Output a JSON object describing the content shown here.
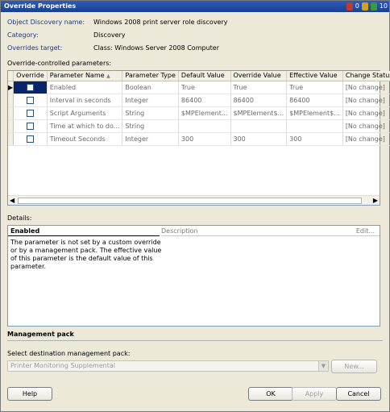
{
  "window": {
    "title": "Override Properties",
    "tray_count_1": "0",
    "tray_count_2": "10"
  },
  "info": {
    "discovery_label": "Object Discovery name:",
    "discovery_value": "Windows 2008 print server role discovery",
    "category_label": "Category:",
    "category_value": "Discovery",
    "target_label": "Overrides target:",
    "target_value": "Class: Windows Server 2008 Computer"
  },
  "params": {
    "section_label": "Override-controlled parameters:",
    "columns": [
      "Override",
      "Parameter Name",
      "Parameter Type",
      "Default Value",
      "Override Value",
      "Effective Value",
      "Change Status"
    ],
    "rows": [
      {
        "name": "Enabled",
        "type": "Boolean",
        "default": "True",
        "override": "True",
        "effective": "True",
        "status": "[No change]"
      },
      {
        "name": "Interval in seconds",
        "type": "Integer",
        "default": "86400",
        "override": "86400",
        "effective": "86400",
        "status": "[No change]"
      },
      {
        "name": "Script Arguments",
        "type": "String",
        "default": "$MPElement...",
        "override": "$MPElement$...",
        "effective": "$MPElement$...",
        "status": "[No change]"
      },
      {
        "name": "Time at which to do...",
        "type": "String",
        "default": "",
        "override": "",
        "effective": "",
        "status": "[No change]"
      },
      {
        "name": "Timeout Seconds",
        "type": "Integer",
        "default": "300",
        "override": "300",
        "effective": "300",
        "status": "[No change]"
      }
    ],
    "sort_glyph": "▲",
    "scroll_left": "◀",
    "scroll_right": "▶",
    "row_pointer": "▶"
  },
  "details": {
    "label": "Details:",
    "heading": "Enabled",
    "description_header": "Description",
    "edit_link": "Edit...",
    "text": "The parameter is not set by a custom override or by a management pack. The effective value of this parameter is the default value of this parameter."
  },
  "management_pack": {
    "heading": "Management pack",
    "select_label": "Select destination management pack:",
    "selected": "Printer Monitoring Supplemental",
    "new_button": "New..."
  },
  "buttons": {
    "help": "Help",
    "ok": "OK",
    "apply": "Apply",
    "cancel": "Cancel"
  },
  "colors": {
    "title_bar": "#1b3f8e",
    "selection": "#0a246a",
    "label_blue": "#1a3a85"
  },
  "icons": {
    "dropdown": "chevron-down-icon",
    "row_pointer": "row-pointer-icon",
    "tray": "notification-icon"
  }
}
